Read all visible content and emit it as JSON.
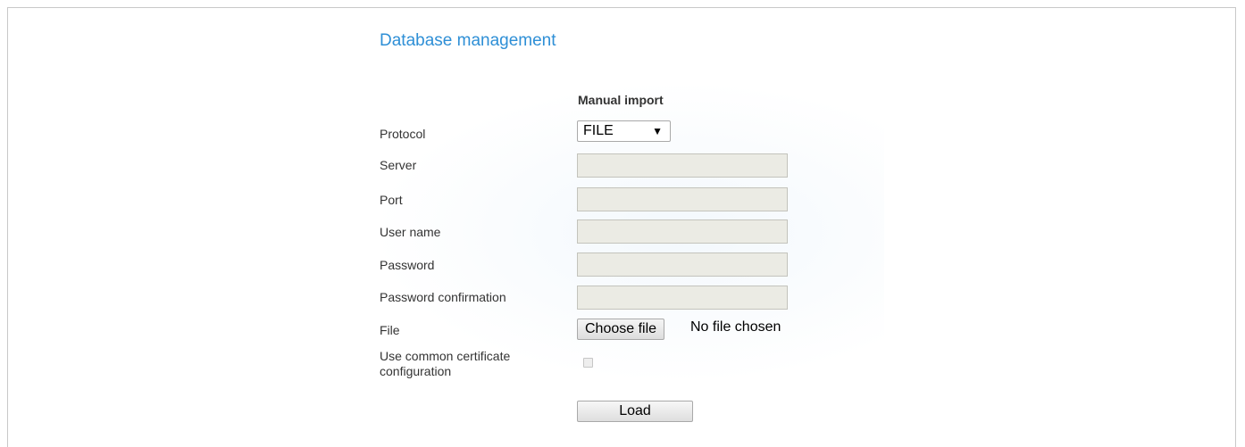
{
  "page": {
    "title": "Database management",
    "section_heading": "Manual import"
  },
  "form": {
    "protocol": {
      "label": "Protocol",
      "selected": "FILE"
    },
    "server": {
      "label": "Server",
      "value": ""
    },
    "port": {
      "label": "Port",
      "value": ""
    },
    "user_name": {
      "label": "User name",
      "value": ""
    },
    "password": {
      "label": "Password",
      "value": ""
    },
    "password_confirmation": {
      "label": "Password confirmation",
      "value": ""
    },
    "file": {
      "label": "File",
      "button_label": "Choose file",
      "status": "No file chosen"
    },
    "use_common_certificate": {
      "label_line1": "Use common certificate",
      "label_line2": "configuration",
      "checked": false
    },
    "load_button": "Load"
  },
  "colors": {
    "title": "#2e8fd6",
    "disabled_input": "#ebebe4"
  }
}
